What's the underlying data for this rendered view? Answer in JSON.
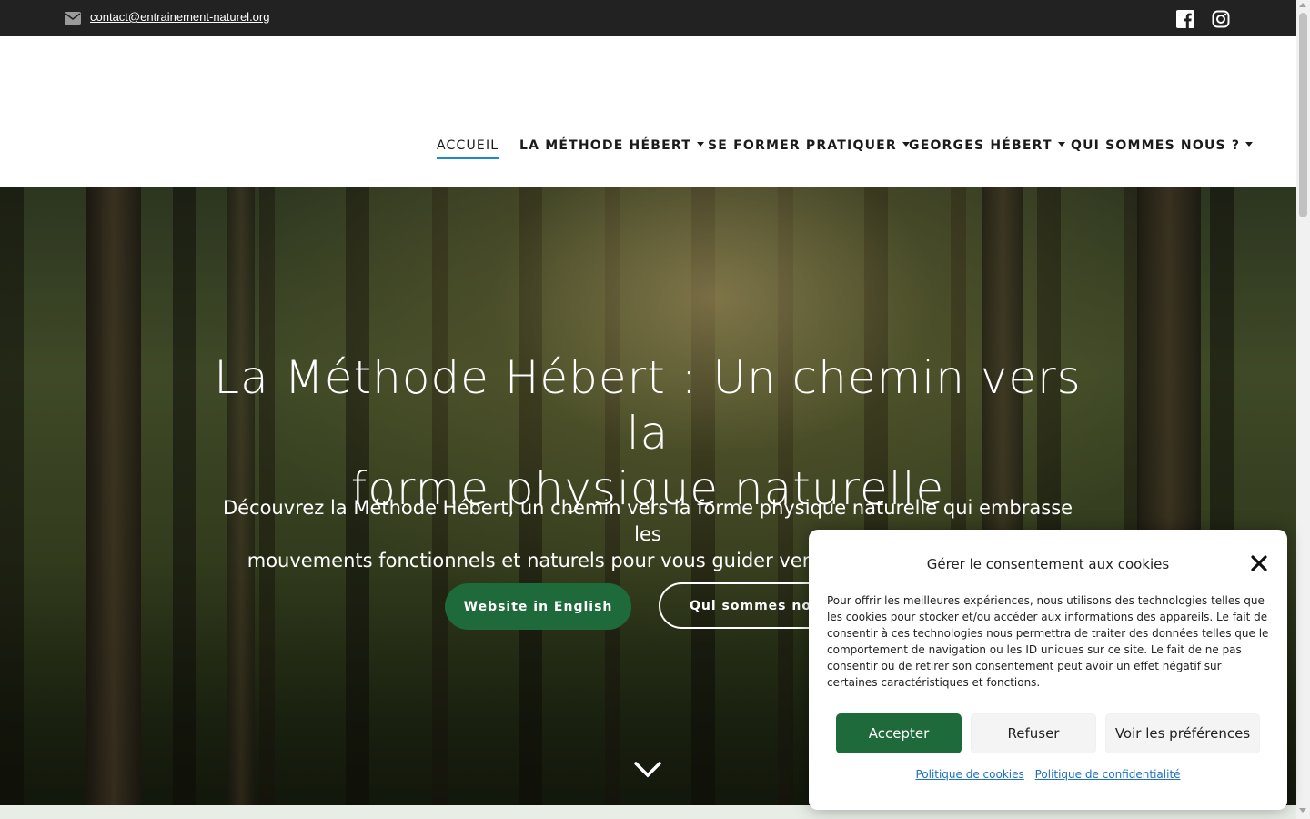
{
  "topbar": {
    "email": "contact@entrainement-naturel.org",
    "icons": [
      "mail-icon",
      "facebook-icon",
      "instagram-icon"
    ]
  },
  "nav": {
    "items": [
      {
        "label": "ACCUEIL",
        "active": true,
        "dropdown": false
      },
      {
        "label": "LA MÉTHODE HÉBERT",
        "active": false,
        "dropdown": true
      },
      {
        "label": "SE FORMER PRATIQUER",
        "active": false,
        "dropdown": true
      },
      {
        "label": "GEORGES HÉBERT",
        "active": false,
        "dropdown": true
      },
      {
        "label": "QUI SOMMES NOUS ?",
        "active": false,
        "dropdown": true
      }
    ]
  },
  "hero": {
    "title_line1": "La Méthode Hébert : Un chemin vers la",
    "title_line2": "forme physique naturelle",
    "subtitle_line1": "Découvrez la Méthode Hébert, un chemin vers la forme physique naturelle qui embrasse les",
    "subtitle_line2": "mouvements fonctionnels et naturels pour vous guider vers un bien-être holistique.",
    "button_primary": "Website in English",
    "button_secondary": "Qui sommes nous ?"
  },
  "cookie": {
    "title": "Gérer le consentement aux cookies",
    "body": "Pour offrir les meilleures expériences, nous utilisons des technologies telles que les cookies pour stocker et/ou accéder aux informations des appareils. Le fait de consentir à ces technologies nous permettra de traiter des données telles que le comportement de navigation ou les ID uniques sur ce site. Le fait de ne pas consentir ou de retirer son consentement peut avoir un effet négatif sur certaines caractéristiques et fonctions.",
    "accept": "Accepter",
    "refuse": "Refuser",
    "preferences": "Voir les préférences",
    "link_cookies": "Politique de cookies",
    "link_privacy": "Politique de confidentialité"
  },
  "colors": {
    "topbar": "#222222",
    "accent_green": "#1e6a3a",
    "active_underline": "#1e88c8",
    "link_blue": "#1e6fbf"
  }
}
